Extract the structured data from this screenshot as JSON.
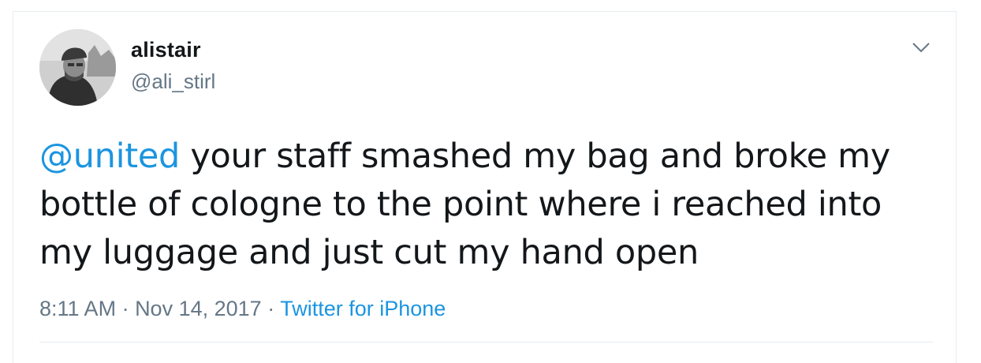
{
  "tweet": {
    "author": {
      "name": "alistair",
      "handle": "@ali_stirl",
      "avatar_icon": "profile-photo"
    },
    "menu_icon": "chevron-down-icon",
    "mention": "@united",
    "text_rest": " your staff smashed my bag and broke my bottle of cologne to the point where i reached into my luggage and just cut my hand open",
    "time": "8:11 AM",
    "separator": " · ",
    "date": "Nov 14, 2017",
    "source": "Twitter for iPhone"
  },
  "colors": {
    "link": "#1b95e0",
    "text": "#14171a",
    "secondary": "#657786",
    "border": "#e6ecf0"
  }
}
